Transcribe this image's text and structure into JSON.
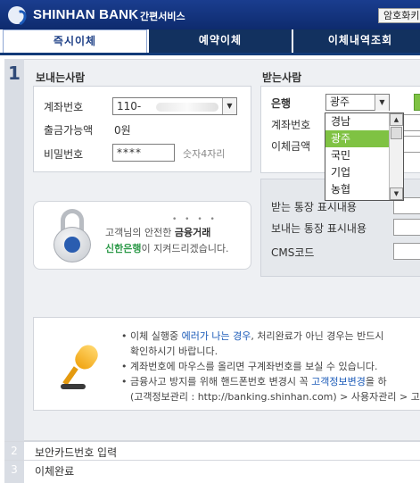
{
  "header": {
    "brand": "SHINHAN BANK",
    "service": "간편서비스",
    "cert_button": "암호화키"
  },
  "tabs": [
    {
      "label": "즉시이체",
      "active": true
    },
    {
      "label": "예약이체",
      "active": false
    },
    {
      "label": "이체내역조회",
      "active": false
    }
  ],
  "steps": {
    "step1": "1",
    "step2_num": "2",
    "step2_label": "보안카드번호 입력",
    "step3_num": "3",
    "step3_label": "이체완료"
  },
  "sender": {
    "title": "보내는사람",
    "account_label": "계좌번호",
    "account_value": "110-",
    "balance_label": "출금가능액",
    "balance_value": "0원",
    "password_label": "비밀번호",
    "password_value": "****",
    "password_hint": "숫자4자리"
  },
  "secure": {
    "dots": "• • • •",
    "line1_pre": "고객님의 안전한 ",
    "line1_bold": "금융거래",
    "line2_bold": "신한은행",
    "line2_post": "이 지켜드리겠습니다."
  },
  "receiver": {
    "title": "받는사람",
    "bank_label": "은행",
    "bank_value": "광주",
    "account_label": "계좌번호",
    "amount_label": "이체금액",
    "recv_memo_label": "받는 통장 표시내용",
    "send_memo_label": "보내는 통장 표시내용",
    "cms_label": "CMS코드"
  },
  "bank_dropdown": {
    "options": [
      "경남",
      "광주",
      "국민",
      "기업",
      "농협"
    ],
    "selected": "광주"
  },
  "notice": {
    "l1_pre": "• 이체 실행중 ",
    "l1_hl": "에러가 나는 경우",
    "l1_post": ", 처리완료가 아닌 경우는 반드시",
    "l2": "확인하시기 바랍니다.",
    "l3": "• 계좌번호에 마우스를 올리면 구계좌번호를 보실 수 있습니다.",
    "l4_pre": "• 금융사고 방지를 위해 핸드폰번호 변경시 꼭 ",
    "l4_hl": "고객정보변경",
    "l4_post": "을 하",
    "l5": "(고객정보관리 : http://banking.shinhan.com) > 사용자관리 > 고"
  },
  "colors": {
    "header_bg": "#1a3d8f",
    "tab_active_text": "#1d3f86",
    "tab_inactive_bg": "#12315f",
    "accent_green": "#7fc243",
    "highlight_blue": "#1a5ab8"
  }
}
